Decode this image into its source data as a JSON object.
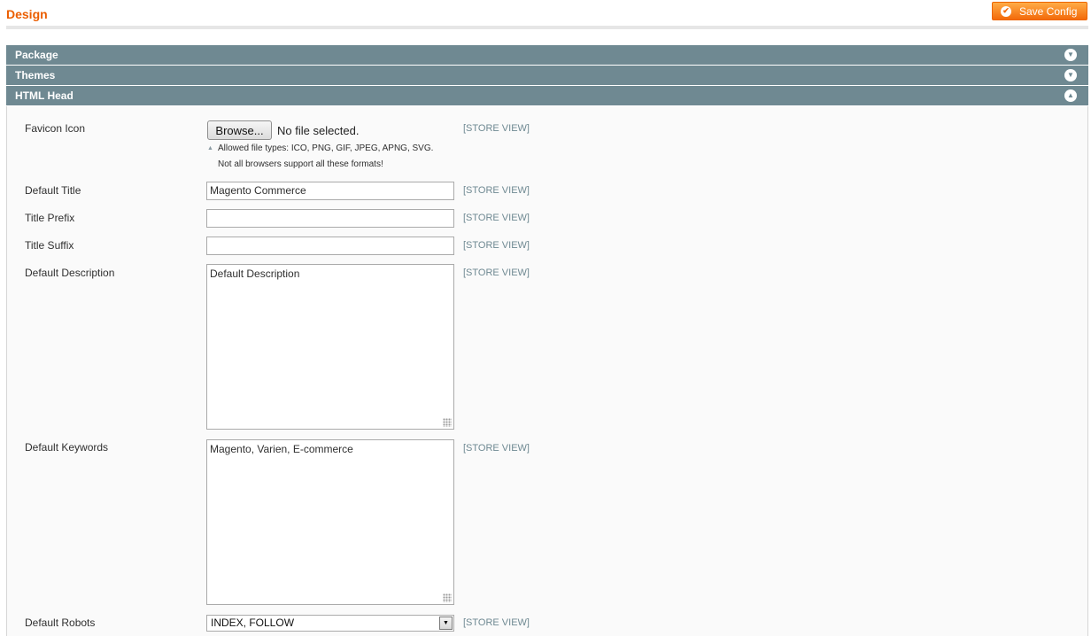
{
  "header": {
    "title": "Design",
    "save_label": "Save Config"
  },
  "sections": [
    {
      "label": "Package",
      "state": "collapsed"
    },
    {
      "label": "Themes",
      "state": "collapsed"
    },
    {
      "label": "HTML Head",
      "state": "expanded"
    }
  ],
  "fields": {
    "favicon": {
      "label": "Favicon Icon",
      "browse_label": "Browse...",
      "file_status": "No file selected.",
      "note_1": "Allowed file types: ICO, PNG, GIF, JPEG, APNG, SVG.",
      "note_2": "Not all browsers support all these formats!",
      "scope": "[STORE VIEW]"
    },
    "default_title": {
      "label": "Default Title",
      "value": "Magento Commerce",
      "scope": "[STORE VIEW]"
    },
    "title_prefix": {
      "label": "Title Prefix",
      "value": "",
      "scope": "[STORE VIEW]"
    },
    "title_suffix": {
      "label": "Title Suffix",
      "value": "",
      "scope": "[STORE VIEW]"
    },
    "default_description": {
      "label": "Default Description",
      "value": "Default Description",
      "scope": "[STORE VIEW]"
    },
    "default_keywords": {
      "label": "Default Keywords",
      "value": "Magento, Varien, E-commerce",
      "scope": "[STORE VIEW]"
    },
    "default_robots": {
      "label": "Default Robots",
      "value": "INDEX, FOLLOW",
      "scope": "[STORE VIEW]"
    }
  },
  "colors": {
    "accent": "#eb5e00",
    "section_header": "#6f8992",
    "scope_text": "#6f8992"
  },
  "icons": {
    "save": "check-circle-icon",
    "collapsed": "chevron-down-circle-icon",
    "expanded": "chevron-up-circle-icon"
  }
}
